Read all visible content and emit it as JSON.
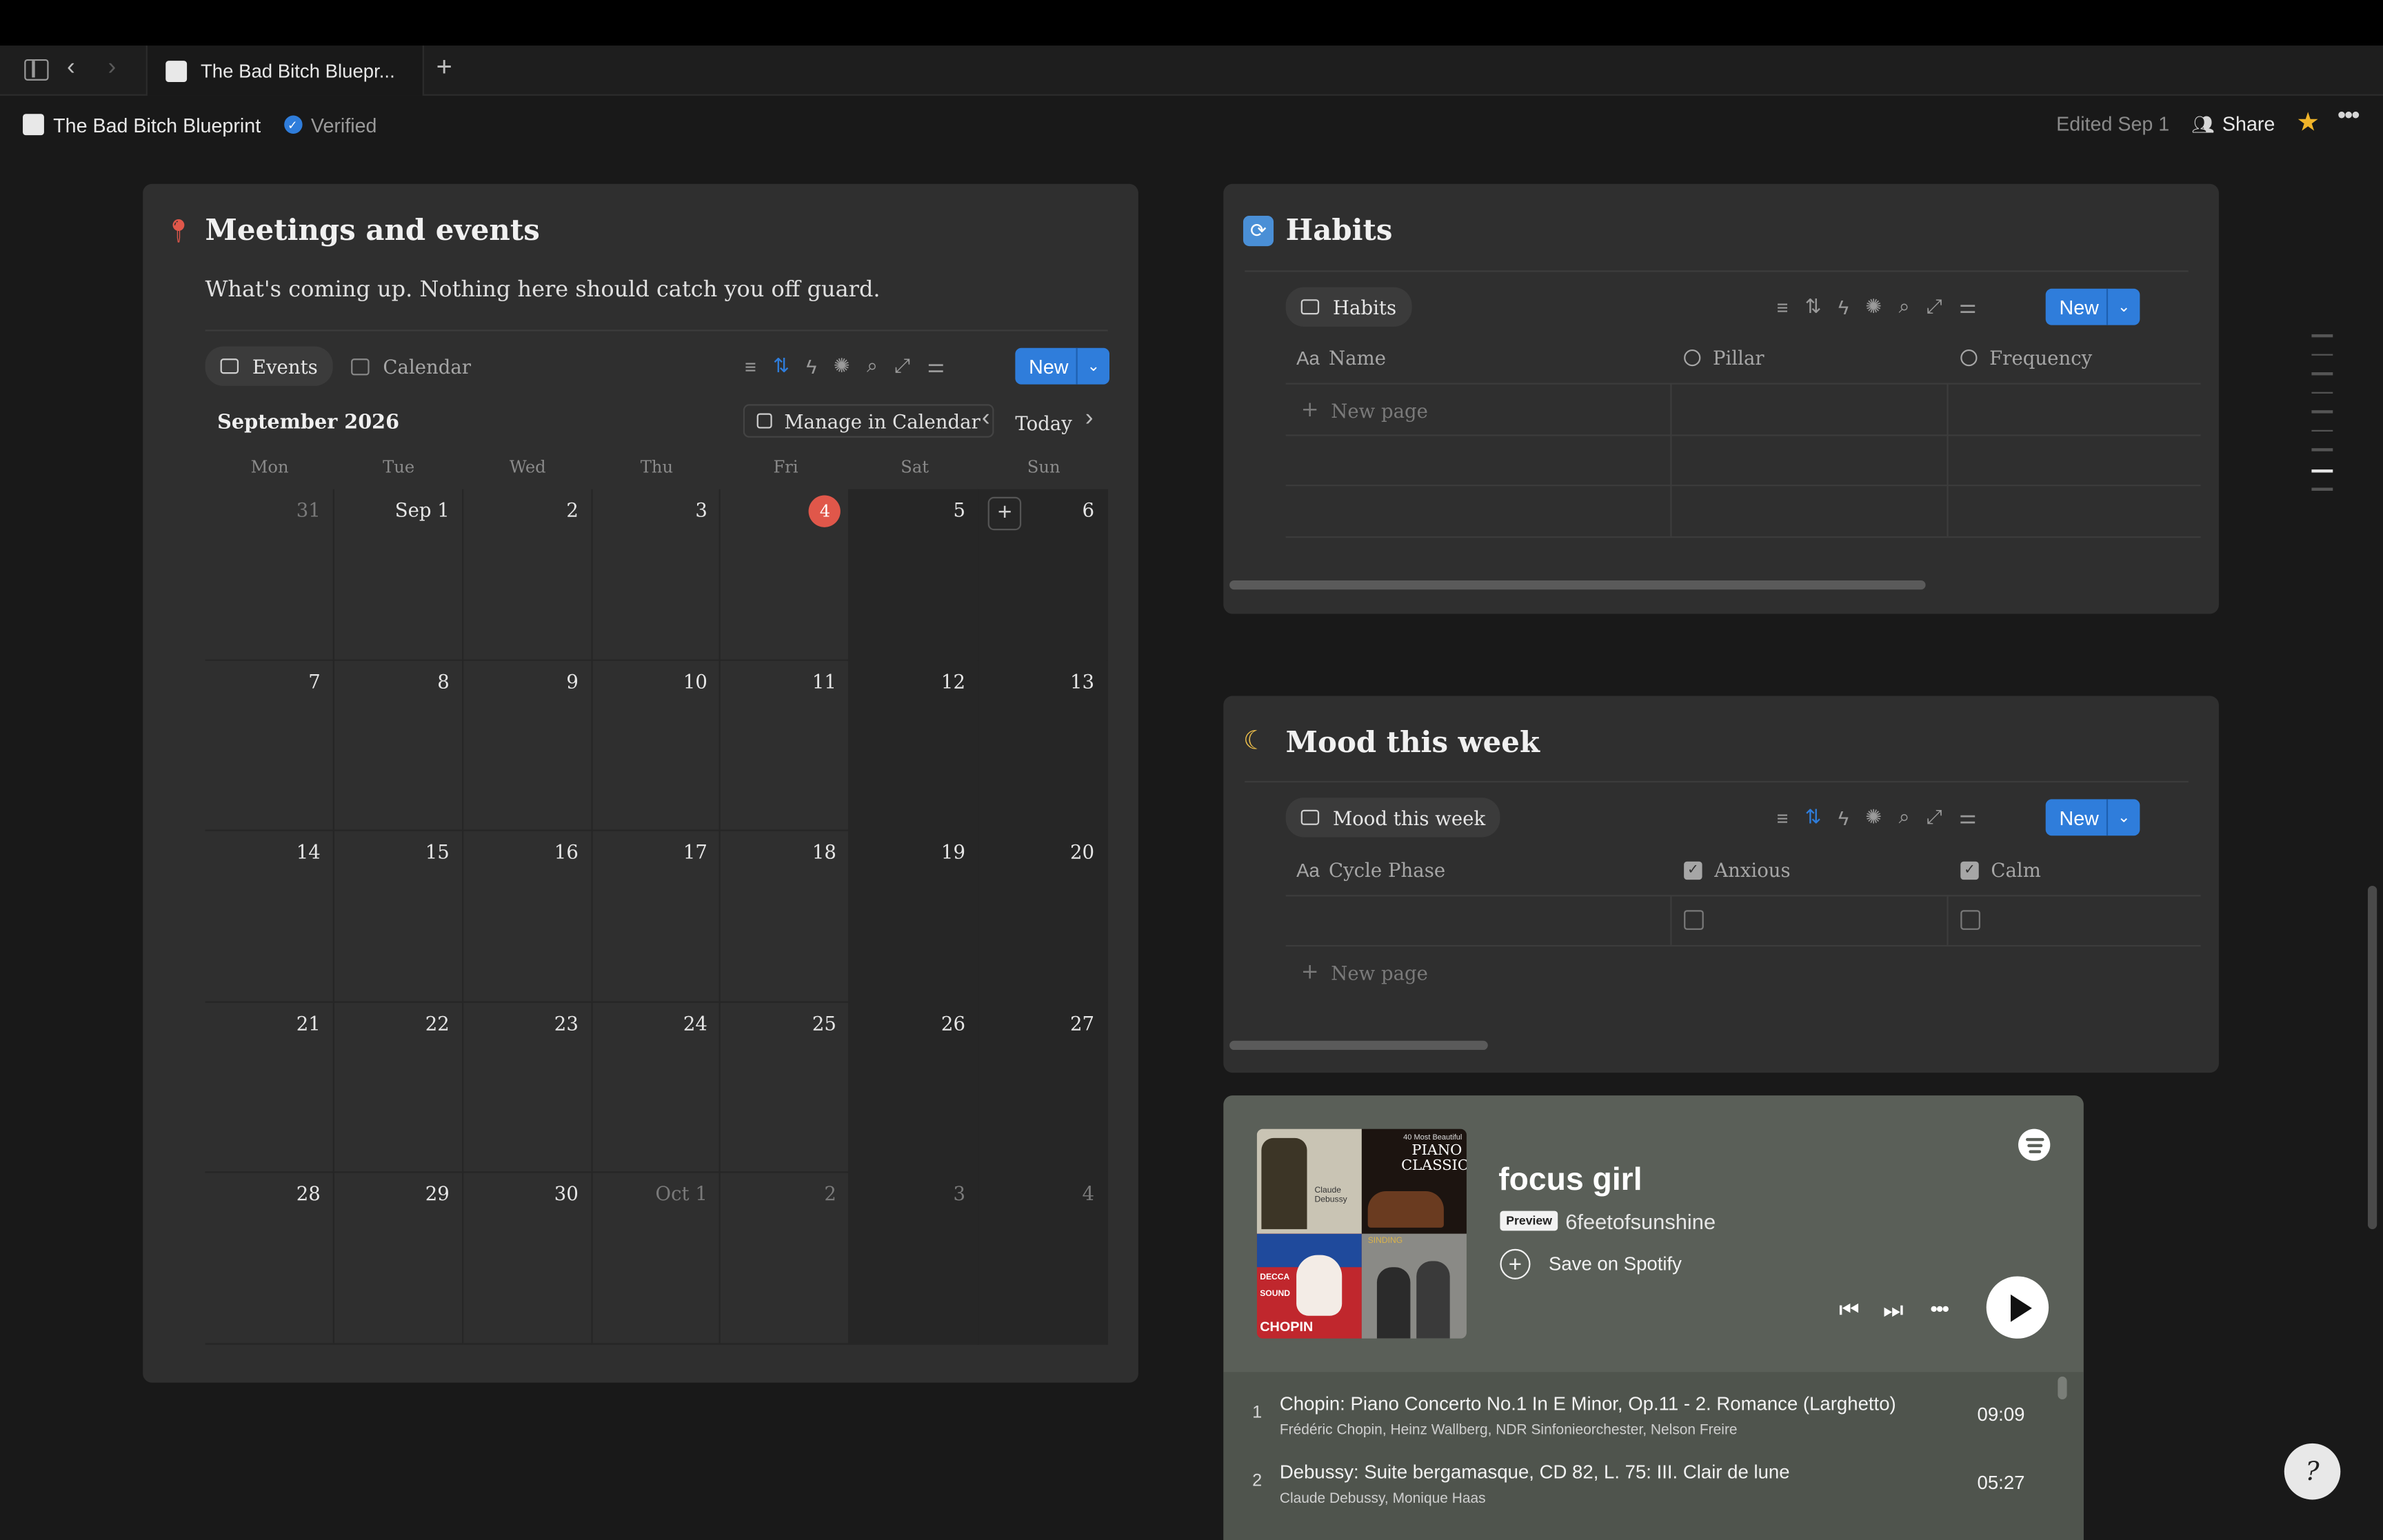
{
  "tab": {
    "title": "The Bad Bitch Bluepr..."
  },
  "header": {
    "title": "The Bad Bitch Blueprint",
    "verified": "Verified",
    "edited": "Edited Sep 1",
    "share": "Share"
  },
  "meetings": {
    "title": "Meetings and events",
    "subtitle": "What's coming up. Nothing here should catch you off guard.",
    "view_events": "Events",
    "view_calendar": "Calendar",
    "new": "New",
    "month": "September 2026",
    "manage": "Manage in Calendar",
    "today": "Today",
    "weekdays": [
      "Mon",
      "Tue",
      "Wed",
      "Thu",
      "Fri",
      "Sat",
      "Sun"
    ],
    "weeks": [
      [
        "31",
        "Sep 1",
        "2",
        "3",
        "4",
        "5",
        "6"
      ],
      [
        "7",
        "8",
        "9",
        "10",
        "11",
        "12",
        "13"
      ],
      [
        "14",
        "15",
        "16",
        "17",
        "18",
        "19",
        "20"
      ],
      [
        "21",
        "22",
        "23",
        "24",
        "25",
        "26",
        "27"
      ],
      [
        "28",
        "29",
        "30",
        "Oct 1",
        "2",
        "3",
        "4"
      ]
    ]
  },
  "habits": {
    "title": "Habits",
    "view": "Habits",
    "new": "New",
    "columns": [
      "Name",
      "Pillar",
      "Frequency"
    ],
    "new_page": "New page"
  },
  "mood": {
    "title": "Mood this week",
    "view": "Mood this week",
    "new": "New",
    "columns": [
      "Cycle Phase",
      "Anxious",
      "Calm"
    ],
    "new_page": "New page"
  },
  "spotify": {
    "playlist": "focus girl",
    "preview": "Preview",
    "owner": "6feetofsunshine",
    "save": "Save on Spotify",
    "cover_text": {
      "piano": "PIANO CLASSICS",
      "piano_top": "40 Most Beautiful",
      "decca": "DECCA SOUND",
      "chopin": "CHOPIN",
      "debussy": "Claude Debussy",
      "sinding": "SINDING"
    },
    "tracks": [
      {
        "n": "1",
        "title": "Chopin: Piano Concerto No.1 In E Minor, Op.11 - 2. Romance (Larghetto)",
        "artists": "Frédéric Chopin, Heinz Wallberg, NDR Sinfonieorchester, Nelson Freire",
        "time": "09:09"
      },
      {
        "n": "2",
        "title": "Debussy: Suite bergamasque, CD 82, L. 75: III. Clair de lune",
        "artists": "Claude Debussy, Monique Haas",
        "time": "05:27"
      }
    ]
  },
  "colors": {
    "accent": "#2f7ddb",
    "today": "#e0574a",
    "star": "#f0b429",
    "panel": "#2f2f2f",
    "page": "#191919"
  }
}
